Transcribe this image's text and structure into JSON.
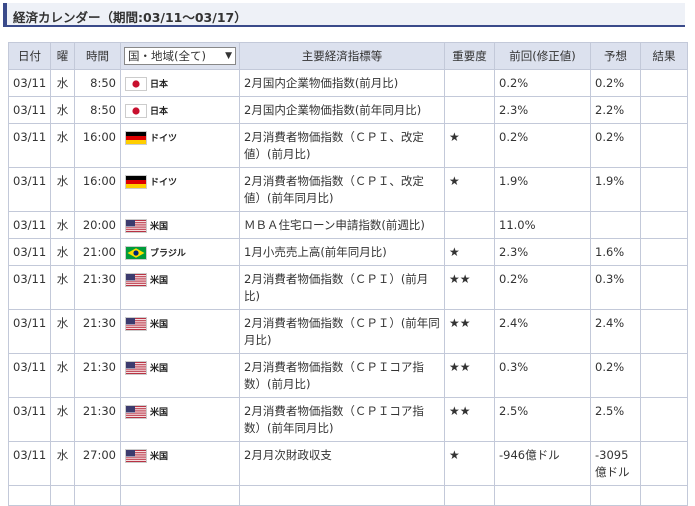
{
  "header": {
    "title": "経済カレンダー（期間:03/11～03/17）"
  },
  "columns": {
    "date": "日付",
    "weekday": "曜",
    "time": "時間",
    "region_select": "国・地域(全て)",
    "indicator": "主要経済指標等",
    "importance": "重要度",
    "previous": "前回(修正値)",
    "forecast": "予想",
    "result": "結果"
  },
  "rows": [
    {
      "date": "03/11",
      "weekday": "水",
      "time": "8:50",
      "flag": "jp",
      "country": "日本",
      "indicator": "2月国内企業物価指数(前月比)",
      "stars": "",
      "previous": "0.2%",
      "forecast": "0.2%",
      "result": ""
    },
    {
      "date": "03/11",
      "weekday": "水",
      "time": "8:50",
      "flag": "jp",
      "country": "日本",
      "indicator": "2月国内企業物価指数(前年同月比)",
      "stars": "",
      "previous": "2.3%",
      "forecast": "2.2%",
      "result": ""
    },
    {
      "date": "03/11",
      "weekday": "水",
      "time": "16:00",
      "flag": "de",
      "country": "ドイツ",
      "indicator": "2月消費者物価指数（ＣＰＩ、改定値）(前月比)",
      "stars": "★",
      "previous": "0.2%",
      "forecast": "0.2%",
      "result": ""
    },
    {
      "date": "03/11",
      "weekday": "水",
      "time": "16:00",
      "flag": "de",
      "country": "ドイツ",
      "indicator": "2月消費者物価指数（ＣＰＩ、改定値）(前年同月比)",
      "stars": "★",
      "previous": "1.9%",
      "forecast": "1.9%",
      "result": ""
    },
    {
      "date": "03/11",
      "weekday": "水",
      "time": "20:00",
      "flag": "us",
      "country": "米国",
      "indicator": "ＭＢＡ住宅ローン申請指数(前週比)",
      "stars": "",
      "previous": "11.0%",
      "forecast": "",
      "result": ""
    },
    {
      "date": "03/11",
      "weekday": "水",
      "time": "21:00",
      "flag": "br",
      "country": "ブラジル",
      "indicator": "1月小売売上高(前年同月比)",
      "stars": "★",
      "previous": "2.3%",
      "forecast": "1.6%",
      "result": ""
    },
    {
      "date": "03/11",
      "weekday": "水",
      "time": "21:30",
      "flag": "us",
      "country": "米国",
      "indicator": "2月消費者物価指数（ＣＰＩ）(前月比)",
      "stars": "★★",
      "previous": "0.2%",
      "forecast": "0.3%",
      "result": ""
    },
    {
      "date": "03/11",
      "weekday": "水",
      "time": "21:30",
      "flag": "us",
      "country": "米国",
      "indicator": "2月消費者物価指数（ＣＰＩ）(前年同月比)",
      "stars": "★★",
      "previous": "2.4%",
      "forecast": "2.4%",
      "result": ""
    },
    {
      "date": "03/11",
      "weekday": "水",
      "time": "21:30",
      "flag": "us",
      "country": "米国",
      "indicator": "2月消費者物価指数（ＣＰＩコア指数）(前月比)",
      "stars": "★★",
      "previous": "0.3%",
      "forecast": "0.2%",
      "result": ""
    },
    {
      "date": "03/11",
      "weekday": "水",
      "time": "21:30",
      "flag": "us",
      "country": "米国",
      "indicator": "2月消費者物価指数（ＣＰＩコア指数）(前年同月比)",
      "stars": "★★",
      "previous": "2.5%",
      "forecast": "2.5%",
      "result": ""
    },
    {
      "date": "03/11",
      "weekday": "水",
      "time": "27:00",
      "flag": "us",
      "country": "米国",
      "indicator": "2月月次財政収支",
      "stars": "★",
      "previous": "-946億ドル",
      "forecast": "-3095億ドル",
      "result": ""
    }
  ]
}
